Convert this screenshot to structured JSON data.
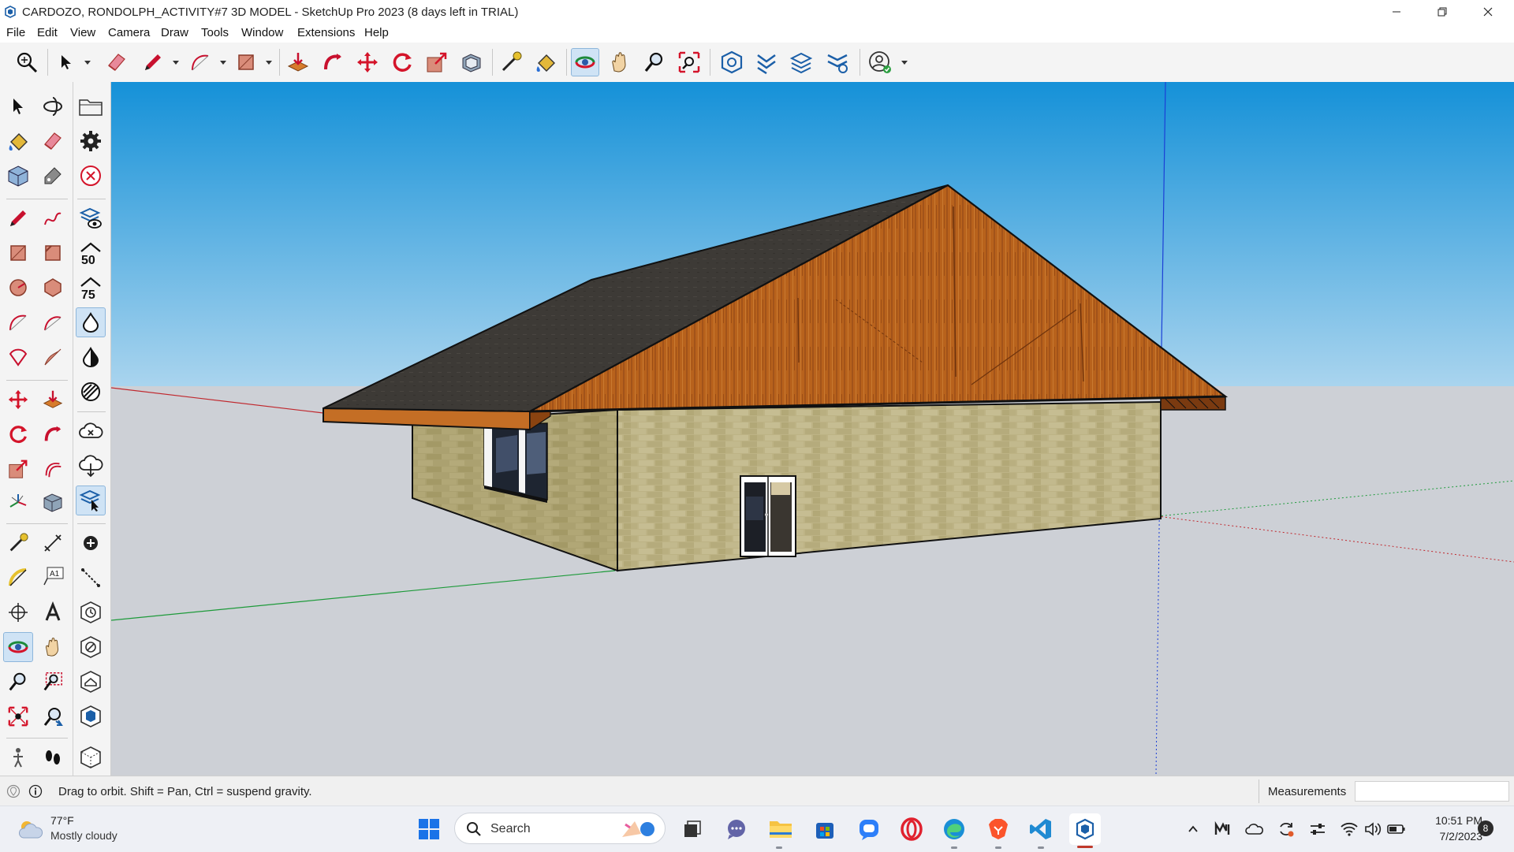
{
  "window": {
    "title": "CARDOZO, RONDOLPH_ACTIVITY#7 3D MODEL - SketchUp Pro 2023 (8 days left in TRIAL)",
    "controls": [
      "minimize-icon",
      "restore-icon",
      "close-icon"
    ]
  },
  "menu": {
    "items": [
      "File",
      "Edit",
      "View",
      "Camera",
      "Draw",
      "Tools",
      "Window",
      "Extensions",
      "Help"
    ]
  },
  "toolbar": {
    "tools": [
      "zoom-extents-icon",
      "select-icon",
      "eraser-icon",
      "pencil-icon",
      "arc-icon",
      "rectangle-icon",
      "push-pull-icon",
      "follow-me-icon",
      "move-icon",
      "rotate-icon",
      "scale-icon",
      "offset-icon",
      "tape-measure-icon",
      "paint-bucket-icon",
      "orbit-icon",
      "pan-icon",
      "zoom-icon",
      "zoom-window-icon",
      "warehouse-icon",
      "extension-warehouse-icon",
      "layout-icon",
      "extension-manager-icon",
      "account-icon"
    ],
    "active_tool": "orbit-icon"
  },
  "left_palette": {
    "active_tool": "orbit-icon",
    "section_numbers": [
      "50",
      "75"
    ],
    "text_label": "A1"
  },
  "status": {
    "hint": "Drag to orbit. Shift = Pan, Ctrl = suspend gravity.",
    "measurements_label": "Measurements",
    "measurements_value": ""
  },
  "colors": {
    "sky_top": "#1591d8",
    "sky_bottom": "#a9d4ee",
    "ground": "#cdd0d6",
    "roof": "#3d3a36",
    "gable_wood": "#b8621c",
    "wall": "#b8ae80",
    "accent_active": "#cfe3f5"
  },
  "taskbar": {
    "weather": {
      "temp": "77°F",
      "condition": "Mostly cloudy"
    },
    "search_placeholder": "Search",
    "apps": [
      "start-icon",
      "widgets-icon",
      "task-view-icon",
      "chat-icon",
      "file-explorer-icon",
      "store-icon",
      "messenger-icon",
      "opera-icon",
      "edge-icon",
      "brave-icon",
      "vscode-icon",
      "sketchup-icon"
    ],
    "clock": {
      "time": "10:51 PM",
      "date": "7/2/2023"
    },
    "notification_count": "8"
  }
}
